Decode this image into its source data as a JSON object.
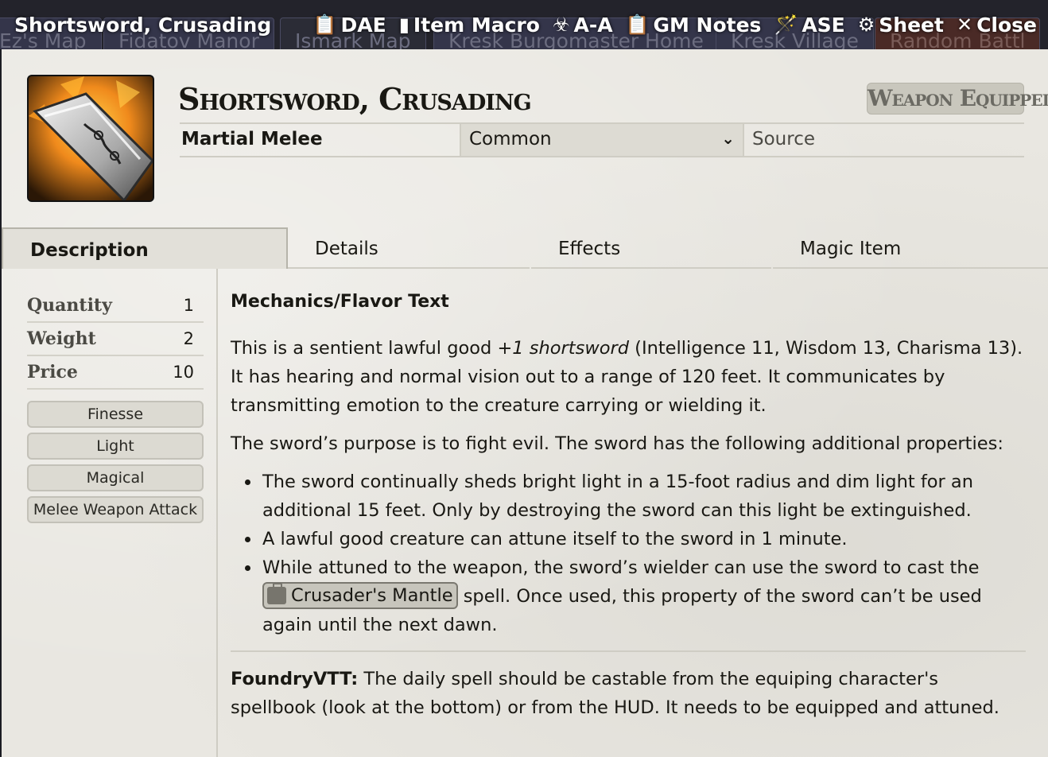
{
  "window": {
    "title": "Shortsword, Crusading",
    "controls": [
      {
        "label": "DAE",
        "icon": "clipboard-icon",
        "glyph": "📋"
      },
      {
        "label": "Item Macro",
        "icon": "sd-card-icon",
        "glyph": "▮"
      },
      {
        "label": "A-A",
        "icon": "biohazard-icon",
        "glyph": "☣"
      },
      {
        "label": "GM Notes",
        "icon": "clipboard-icon",
        "glyph": "📋"
      },
      {
        "label": "ASE",
        "icon": "magic-wand-icon",
        "glyph": "🪄"
      },
      {
        "label": "Sheet",
        "icon": "gear-icon",
        "glyph": "⚙"
      },
      {
        "label": "Close",
        "icon": "close-icon",
        "glyph": "✕"
      }
    ]
  },
  "scene_tabs": [
    "Ez's Map",
    "Fidatov Manor",
    "Ismark Map",
    "Kresk Burgomaster Home",
    "Kresk Village",
    "Random Battl"
  ],
  "item": {
    "name": "Shortsword, Crusading",
    "status": "Weapon Equipped",
    "type": "Martial Melee",
    "rarity": "Common",
    "source_placeholder": "Source"
  },
  "tabs": [
    "Description",
    "Details",
    "Effects",
    "Magic Item"
  ],
  "sidebar": {
    "stats": [
      {
        "label": "Quantity",
        "value": "1"
      },
      {
        "label": "Weight",
        "value": "2"
      },
      {
        "label": "Price",
        "value": "10"
      }
    ],
    "properties": [
      "Finesse",
      "Light",
      "Magical",
      "Melee Weapon Attack"
    ]
  },
  "description": {
    "heading": "Mechanics/Flavor Text",
    "p1_a": "This is a sentient lawful good ",
    "p1_em": "+1 shortsword",
    "p1_b": " (Intelligence 11, Wisdom 13, Charisma 13). It has hearing and normal vision out to a range of 120 feet. It communicates by transmitting emotion to the creature carrying or wielding it.",
    "p2": "The sword’s purpose is to fight evil. The sword has the following additional properties:",
    "bullet1": "The sword continually sheds bright light in a 15-foot radius and dim light for an additional 15 feet. Only by destroying the sword can this light be extinguished.",
    "bullet2": "A lawful good creature can attune itself to the sword in 1 minute.",
    "bullet3_a": "While attuned to the weapon, the sword’s wielder can use the sword to cast the ",
    "spell_link": "Crusader's Mantle",
    "bullet3_b": " spell. Once used, this property of the sword can’t be used again until the next dawn.",
    "foundry_label": "FoundryVTT:",
    "foundry_text": " The daily spell should be castable from the equiping character's spellbook (look at the bottom) or from the HUD.  It needs to be equipped and attuned."
  }
}
